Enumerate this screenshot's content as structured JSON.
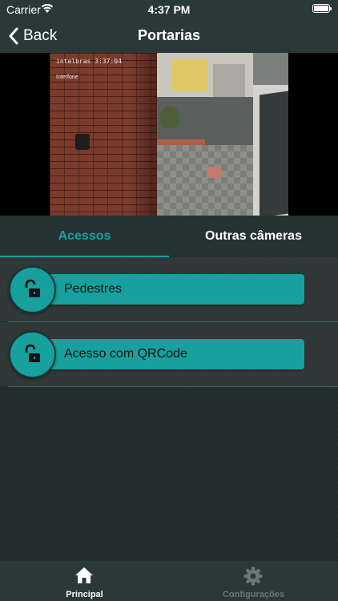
{
  "status_bar": {
    "carrier": "Carrier",
    "time": "4:37 PM"
  },
  "nav": {
    "back_label": "Back",
    "title": "Portarias"
  },
  "camera": {
    "osd_brand": "intelbras",
    "osd_time": "3:37:04",
    "osd_label": "Interfone"
  },
  "tabs": [
    {
      "label": "Acessos",
      "active": true
    },
    {
      "label": "Outras câmeras",
      "active": false
    }
  ],
  "access_items": [
    {
      "label": "Pedestres",
      "icon": "unlock-icon"
    },
    {
      "label": "Acesso com QRCode",
      "icon": "unlock-icon"
    }
  ],
  "tab_bar": [
    {
      "label": "Principal",
      "icon": "home-icon",
      "active": true
    },
    {
      "label": "Configurações",
      "icon": "gear-icon",
      "active": false
    }
  ],
  "colors": {
    "accent": "#17a09d",
    "bar": "#2a3938",
    "background": "#232c2c"
  }
}
